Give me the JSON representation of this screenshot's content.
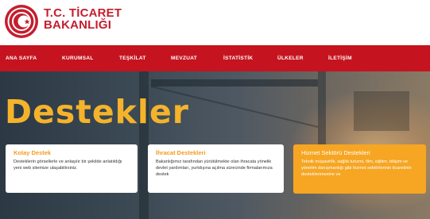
{
  "brand": {
    "line1": "T.C. TİCARET",
    "line2": "BAKANLIĞI",
    "color": "#c41e2e"
  },
  "nav": {
    "items": [
      "ANA SAYFA",
      "KURUMSAL",
      "TEŞKİLAT",
      "MEVZUAT",
      "İSTATİSTİK",
      "ÜLKELER",
      "İLETİŞİM"
    ],
    "background": "#c5141f"
  },
  "hero": {
    "title": "Destekler",
    "title_color": "#f5b32b"
  },
  "cards": [
    {
      "title": "Kolay Destek",
      "text": "Desteklerin görsellerle ve anlaşılır bir şekilde anlatıldığı yeni web sitemize ulaşabilirsiniz."
    },
    {
      "title": "İhracat Destekleri",
      "text": "Bakanlığımız tarafından yürütülmekte olan ihracata yönelik devlet yardımları, yurtdışına açılma sürecinde firmalarımıza destek"
    },
    {
      "title": "Hizmet Sektörü Destekleri",
      "text": "Teknik müşavirlik, sağlık turizmi, film, eğitim, bilişim ve yönetim danışmanlığı gibi hizmet sektörlerinin ticaretinin desteklenmesine ve"
    }
  ],
  "accent": "#f6a623",
  "icons": [
    "ministry-logo-icon"
  ]
}
